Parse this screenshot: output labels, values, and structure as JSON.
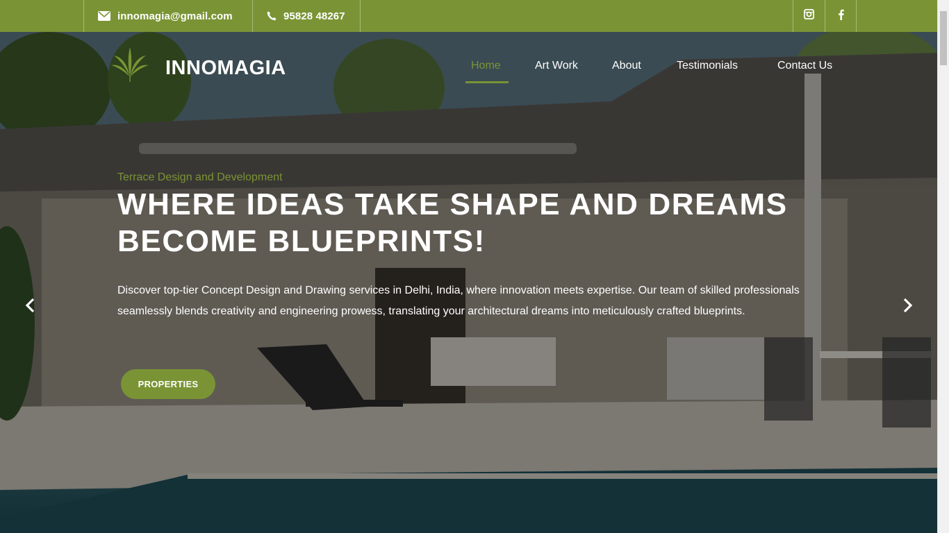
{
  "topbar": {
    "email": "innomagia@gmail.com",
    "phone": "95828 48267",
    "social": [
      "instagram-icon",
      "facebook-icon"
    ]
  },
  "header": {
    "brand": "INNOMAGIA",
    "nav": [
      "Home",
      "Art Work",
      "About",
      "Testimonials",
      "Contact Us"
    ],
    "active_nav": "Home"
  },
  "hero": {
    "eyebrow": "Terrace Design and Development",
    "headline": "WHERE IDEAS TAKE SHAPE AND DREAMS BECOME BLUEPRINTS!",
    "description": "Discover top-tier Concept Design and Drawing services in Delhi, India, where innovation meets expertise. Our team of skilled professionals seamlessly blends creativity and engineering prowess, translating your architectural dreams into meticulously crafted blueprints.",
    "button": "PROPERTIES"
  },
  "colors": {
    "accent": "#7a9435",
    "text_light": "#ffffff"
  }
}
